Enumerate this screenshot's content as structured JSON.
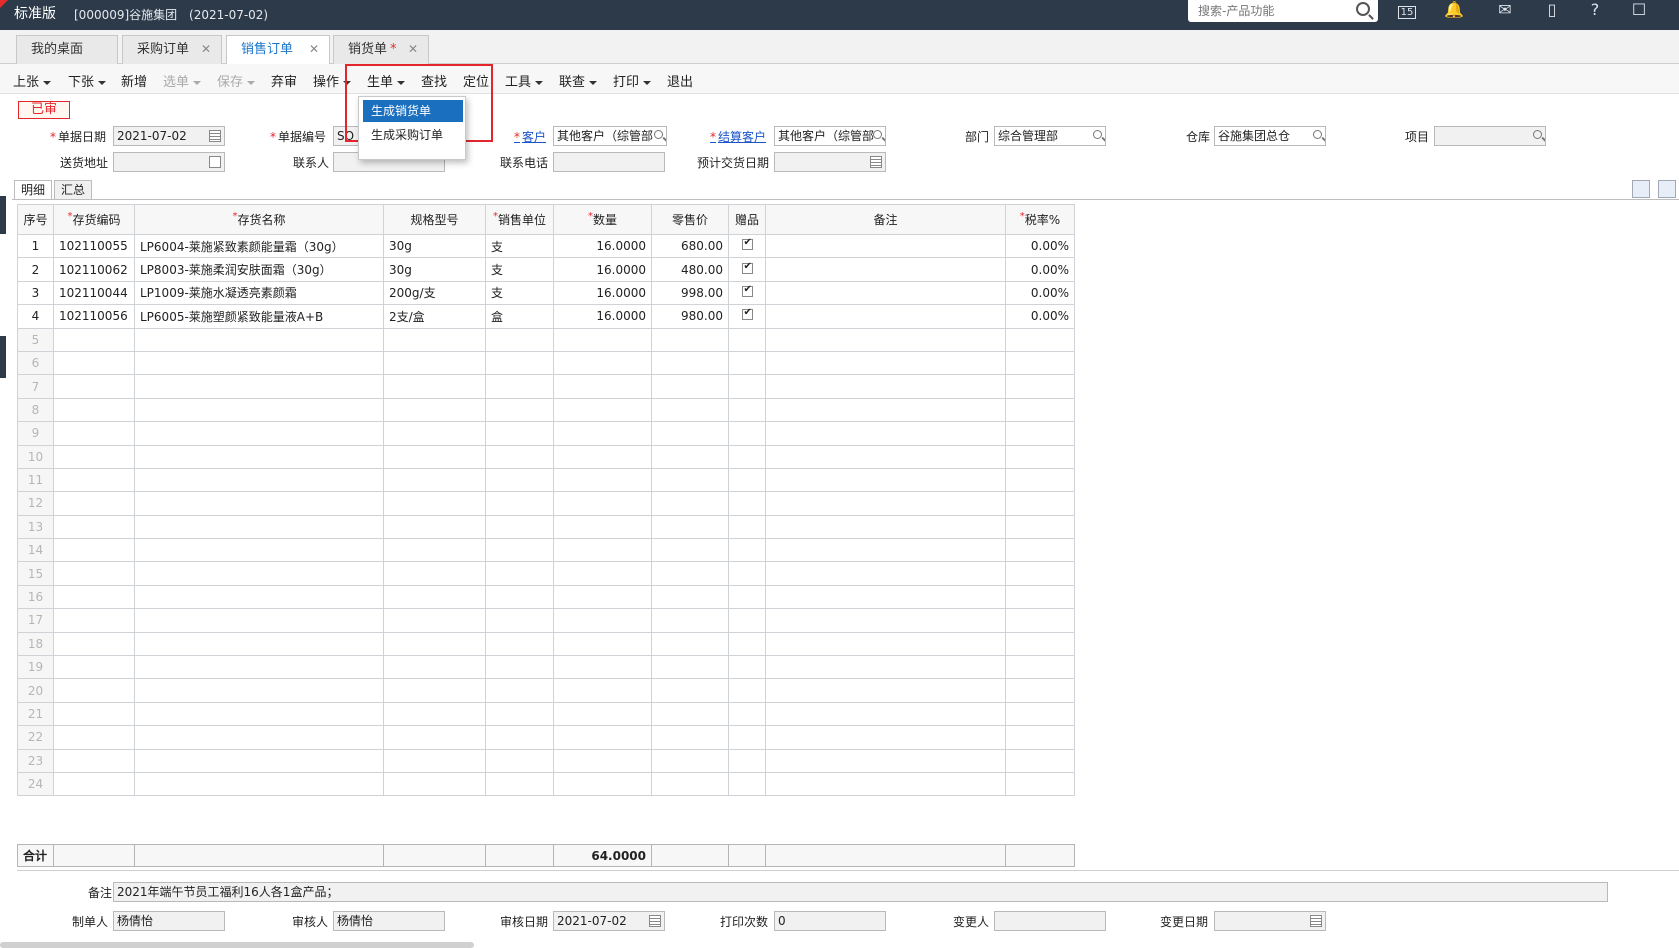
{
  "header": {
    "edition": "标准版",
    "company": "[000009]谷施集团",
    "date": "(2021-07-02)",
    "search_placeholder": "搜索-产品功能",
    "calendar_day": "15"
  },
  "tabs": [
    {
      "label": "我的桌面"
    },
    {
      "label": "采购订单"
    },
    {
      "label": "销售订单"
    },
    {
      "label": "销货单",
      "modified": "*"
    }
  ],
  "toolbar": {
    "prev": "上张",
    "next": "下张",
    "new": "新增",
    "select": "选单",
    "save": "保存",
    "abandon": "弃审",
    "operate": "操作",
    "generate": "生单",
    "find": "查找",
    "locate": "定位",
    "tools": "工具",
    "linked": "联查",
    "print": "打印",
    "exit": "退出"
  },
  "generate_menu": {
    "items": [
      "生成销货单",
      "生成采购订单"
    ],
    "selected_index": 0
  },
  "status": "已审",
  "form": {
    "doc_date_label": "单据日期",
    "doc_date": "2021-07-02",
    "doc_no_label": "单据编号",
    "doc_no": "SO",
    "customer_label": "客户",
    "customer": "其他客户（综管部",
    "settle_customer_label": "结算客户",
    "settle_customer": "其他客户（综管部",
    "dept_label": "部门",
    "dept": "综合管理部",
    "warehouse_label": "仓库",
    "warehouse": "谷施集团总仓",
    "project_label": "项目",
    "project": "",
    "address_label": "送货地址",
    "address": "",
    "contact_label": "联系人",
    "contact": "",
    "phone_label": "联系电话",
    "phone": "",
    "expected_date_label": "预计交货日期",
    "expected_date": ""
  },
  "subtabs": [
    "明细",
    "汇总"
  ],
  "grid": {
    "columns": [
      "序号",
      "存货编码",
      "存货名称",
      "规格型号",
      "销售单位",
      "数量",
      "零售价",
      "赠品",
      "备注",
      "税率%"
    ],
    "required": [
      false,
      true,
      true,
      false,
      true,
      true,
      false,
      false,
      false,
      true
    ],
    "rows": [
      {
        "no": "1",
        "code": "102110055",
        "name": "LP6004-莱施紧致素颜能量霜（30g）",
        "spec": "30g",
        "unit": "支",
        "qty": "16.0000",
        "price": "680.00",
        "gift": true,
        "note": "",
        "tax": "0.00%"
      },
      {
        "no": "2",
        "code": "102110062",
        "name": "LP8003-莱施柔润安肤面霜（30g）",
        "spec": "30g",
        "unit": "支",
        "qty": "16.0000",
        "price": "480.00",
        "gift": true,
        "note": "",
        "tax": "0.00%"
      },
      {
        "no": "3",
        "code": "102110044",
        "name": "LP1009-莱施水凝透亮素颜霜",
        "spec": "200g/支",
        "unit": "支",
        "qty": "16.0000",
        "price": "998.00",
        "gift": true,
        "note": "",
        "tax": "0.00%"
      },
      {
        "no": "4",
        "code": "102110056",
        "name": "LP6005-莱施塑颜紧致能量液A+B",
        "spec": "2支/盒",
        "unit": "盒",
        "qty": "16.0000",
        "price": "980.00",
        "gift": true,
        "note": "",
        "tax": "0.00%"
      }
    ],
    "empty_rows": [
      "5",
      "6",
      "7",
      "8",
      "9",
      "10",
      "11",
      "12",
      "13",
      "14",
      "15",
      "16",
      "17",
      "18",
      "19",
      "20",
      "21",
      "22",
      "23",
      "24"
    ],
    "total_label": "合计",
    "total_qty": "64.0000"
  },
  "footer": {
    "remark_label": "备注",
    "remark": "2021年端午节员工福利16人各1盒产品；",
    "maker_label": "制单人",
    "maker": "杨倩怡",
    "auditor_label": "审核人",
    "auditor": "杨倩怡",
    "audit_date_label": "审核日期",
    "audit_date": "2021-07-02",
    "print_count_label": "打印次数",
    "print_count": "0",
    "changer_label": "变更人",
    "changer": "",
    "change_date_label": "变更日期",
    "change_date": ""
  },
  "colors": {
    "topbar": "#2c3a4a",
    "accent": "#1a6fbf",
    "status_red": "#e3262d"
  }
}
